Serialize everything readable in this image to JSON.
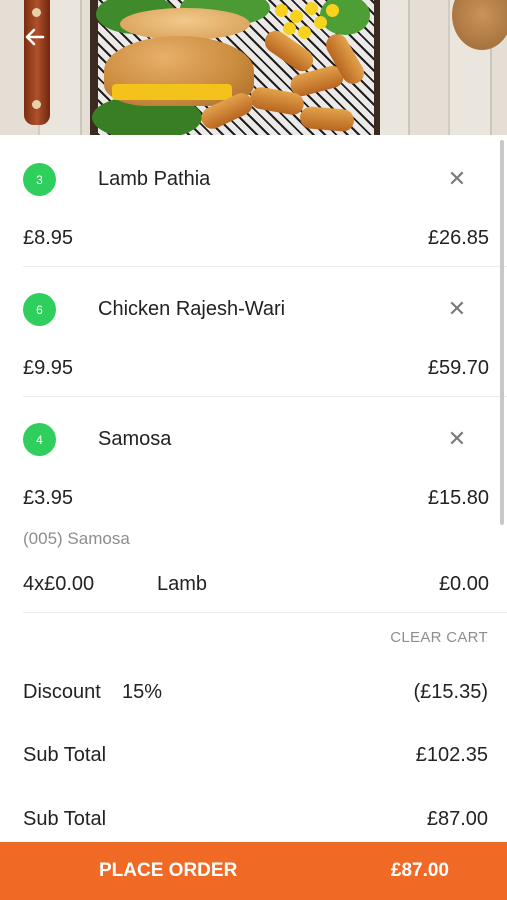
{
  "cart_items": [
    {
      "qty": "3",
      "name": "Lamb Pathia",
      "unit_price": "£8.95",
      "line_total": "£26.85"
    },
    {
      "qty": "6",
      "name": "Chicken Rajesh-Wari",
      "unit_price": "£9.95",
      "line_total": "£59.70"
    },
    {
      "qty": "4",
      "name": "Samosa",
      "unit_price": "£3.95",
      "line_total": "£15.80"
    }
  ],
  "modifier": {
    "title": "(005) Samosa",
    "qty_price": "4x£0.00",
    "name": "Lamb",
    "price": "£0.00"
  },
  "clear_cart_label": "CLEAR CART",
  "summary": {
    "discount_label": "Discount",
    "discount_percent": "15%",
    "discount_value": "(£15.35)",
    "subtotal_label": "Sub Total",
    "subtotal_value": "£102.35",
    "subtotal2_label": "Sub Total",
    "subtotal2_value": "£87.00"
  },
  "order_bar": {
    "label": "PLACE ORDER",
    "total": "£87.00"
  },
  "colors": {
    "accent": "#f16a25",
    "badge": "#2ecf5c",
    "muted": "#8e8e8e"
  },
  "icons": {
    "back": "arrow-left-icon",
    "remove": "close-icon"
  }
}
